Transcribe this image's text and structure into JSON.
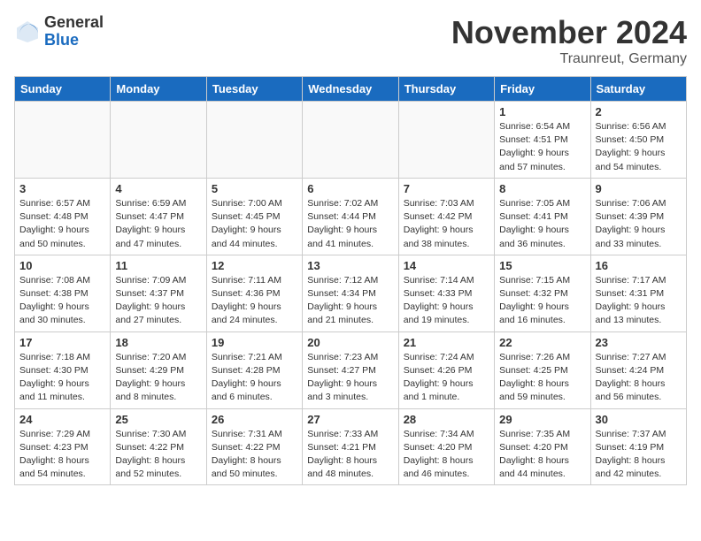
{
  "header": {
    "logo_general": "General",
    "logo_blue": "Blue",
    "month_title": "November 2024",
    "location": "Traunreut, Germany"
  },
  "days_of_week": [
    "Sunday",
    "Monday",
    "Tuesday",
    "Wednesday",
    "Thursday",
    "Friday",
    "Saturday"
  ],
  "weeks": [
    [
      {
        "day": "",
        "info": "",
        "empty": true
      },
      {
        "day": "",
        "info": "",
        "empty": true
      },
      {
        "day": "",
        "info": "",
        "empty": true
      },
      {
        "day": "",
        "info": "",
        "empty": true
      },
      {
        "day": "",
        "info": "",
        "empty": true
      },
      {
        "day": "1",
        "info": "Sunrise: 6:54 AM\nSunset: 4:51 PM\nDaylight: 9 hours\nand 57 minutes.",
        "empty": false
      },
      {
        "day": "2",
        "info": "Sunrise: 6:56 AM\nSunset: 4:50 PM\nDaylight: 9 hours\nand 54 minutes.",
        "empty": false
      }
    ],
    [
      {
        "day": "3",
        "info": "Sunrise: 6:57 AM\nSunset: 4:48 PM\nDaylight: 9 hours\nand 50 minutes.",
        "empty": false
      },
      {
        "day": "4",
        "info": "Sunrise: 6:59 AM\nSunset: 4:47 PM\nDaylight: 9 hours\nand 47 minutes.",
        "empty": false
      },
      {
        "day": "5",
        "info": "Sunrise: 7:00 AM\nSunset: 4:45 PM\nDaylight: 9 hours\nand 44 minutes.",
        "empty": false
      },
      {
        "day": "6",
        "info": "Sunrise: 7:02 AM\nSunset: 4:44 PM\nDaylight: 9 hours\nand 41 minutes.",
        "empty": false
      },
      {
        "day": "7",
        "info": "Sunrise: 7:03 AM\nSunset: 4:42 PM\nDaylight: 9 hours\nand 38 minutes.",
        "empty": false
      },
      {
        "day": "8",
        "info": "Sunrise: 7:05 AM\nSunset: 4:41 PM\nDaylight: 9 hours\nand 36 minutes.",
        "empty": false
      },
      {
        "day": "9",
        "info": "Sunrise: 7:06 AM\nSunset: 4:39 PM\nDaylight: 9 hours\nand 33 minutes.",
        "empty": false
      }
    ],
    [
      {
        "day": "10",
        "info": "Sunrise: 7:08 AM\nSunset: 4:38 PM\nDaylight: 9 hours\nand 30 minutes.",
        "empty": false
      },
      {
        "day": "11",
        "info": "Sunrise: 7:09 AM\nSunset: 4:37 PM\nDaylight: 9 hours\nand 27 minutes.",
        "empty": false
      },
      {
        "day": "12",
        "info": "Sunrise: 7:11 AM\nSunset: 4:36 PM\nDaylight: 9 hours\nand 24 minutes.",
        "empty": false
      },
      {
        "day": "13",
        "info": "Sunrise: 7:12 AM\nSunset: 4:34 PM\nDaylight: 9 hours\nand 21 minutes.",
        "empty": false
      },
      {
        "day": "14",
        "info": "Sunrise: 7:14 AM\nSunset: 4:33 PM\nDaylight: 9 hours\nand 19 minutes.",
        "empty": false
      },
      {
        "day": "15",
        "info": "Sunrise: 7:15 AM\nSunset: 4:32 PM\nDaylight: 9 hours\nand 16 minutes.",
        "empty": false
      },
      {
        "day": "16",
        "info": "Sunrise: 7:17 AM\nSunset: 4:31 PM\nDaylight: 9 hours\nand 13 minutes.",
        "empty": false
      }
    ],
    [
      {
        "day": "17",
        "info": "Sunrise: 7:18 AM\nSunset: 4:30 PM\nDaylight: 9 hours\nand 11 minutes.",
        "empty": false
      },
      {
        "day": "18",
        "info": "Sunrise: 7:20 AM\nSunset: 4:29 PM\nDaylight: 9 hours\nand 8 minutes.",
        "empty": false
      },
      {
        "day": "19",
        "info": "Sunrise: 7:21 AM\nSunset: 4:28 PM\nDaylight: 9 hours\nand 6 minutes.",
        "empty": false
      },
      {
        "day": "20",
        "info": "Sunrise: 7:23 AM\nSunset: 4:27 PM\nDaylight: 9 hours\nand 3 minutes.",
        "empty": false
      },
      {
        "day": "21",
        "info": "Sunrise: 7:24 AM\nSunset: 4:26 PM\nDaylight: 9 hours\nand 1 minute.",
        "empty": false
      },
      {
        "day": "22",
        "info": "Sunrise: 7:26 AM\nSunset: 4:25 PM\nDaylight: 8 hours\nand 59 minutes.",
        "empty": false
      },
      {
        "day": "23",
        "info": "Sunrise: 7:27 AM\nSunset: 4:24 PM\nDaylight: 8 hours\nand 56 minutes.",
        "empty": false
      }
    ],
    [
      {
        "day": "24",
        "info": "Sunrise: 7:29 AM\nSunset: 4:23 PM\nDaylight: 8 hours\nand 54 minutes.",
        "empty": false
      },
      {
        "day": "25",
        "info": "Sunrise: 7:30 AM\nSunset: 4:22 PM\nDaylight: 8 hours\nand 52 minutes.",
        "empty": false
      },
      {
        "day": "26",
        "info": "Sunrise: 7:31 AM\nSunset: 4:22 PM\nDaylight: 8 hours\nand 50 minutes.",
        "empty": false
      },
      {
        "day": "27",
        "info": "Sunrise: 7:33 AM\nSunset: 4:21 PM\nDaylight: 8 hours\nand 48 minutes.",
        "empty": false
      },
      {
        "day": "28",
        "info": "Sunrise: 7:34 AM\nSunset: 4:20 PM\nDaylight: 8 hours\nand 46 minutes.",
        "empty": false
      },
      {
        "day": "29",
        "info": "Sunrise: 7:35 AM\nSunset: 4:20 PM\nDaylight: 8 hours\nand 44 minutes.",
        "empty": false
      },
      {
        "day": "30",
        "info": "Sunrise: 7:37 AM\nSunset: 4:19 PM\nDaylight: 8 hours\nand 42 minutes.",
        "empty": false
      }
    ]
  ]
}
